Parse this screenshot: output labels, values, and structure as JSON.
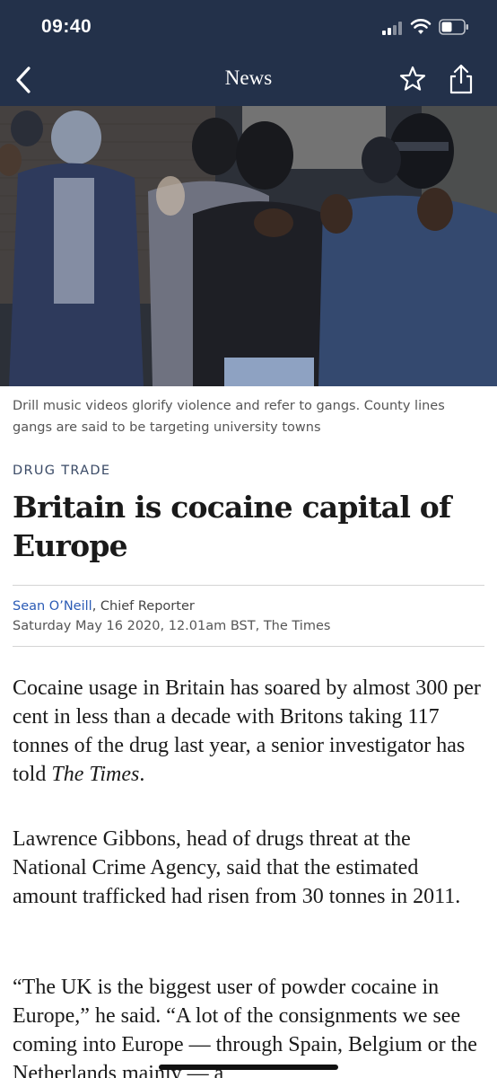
{
  "status_bar": {
    "time": "09:40"
  },
  "nav": {
    "title": "News"
  },
  "hero": {
    "caption": "Drill music videos glorify violence and refer to gangs. County lines gangs are said to be targeting university towns"
  },
  "article": {
    "kicker": "DRUG TRADE",
    "headline": "Britain is cocaine capital of Europe",
    "author": "Sean O’Neill",
    "author_role": ", Chief Reporter",
    "dateline": "Saturday May 16 2020, 12.01am BST, The Times",
    "paragraphs": [
      {
        "text": "Cocaine usage in Britain has soared by almost 300 per cent in less than a decade with Britons taking 117 tonnes of the drug last year, a senior investigator has told ",
        "em": "The Times",
        "tail": "."
      },
      {
        "text": "Lawrence Gibbons, head of drugs threat at the National Crime Agency, said that the estimated amount trafficked had risen from 30 tonnes in 2011."
      },
      {
        "text": "“The UK is the biggest user of powder cocaine in Europe,” he said. “A lot of the consignments we see coming into Europe — through Spain, Belgium or the Netherlands mainly — a"
      }
    ]
  }
}
